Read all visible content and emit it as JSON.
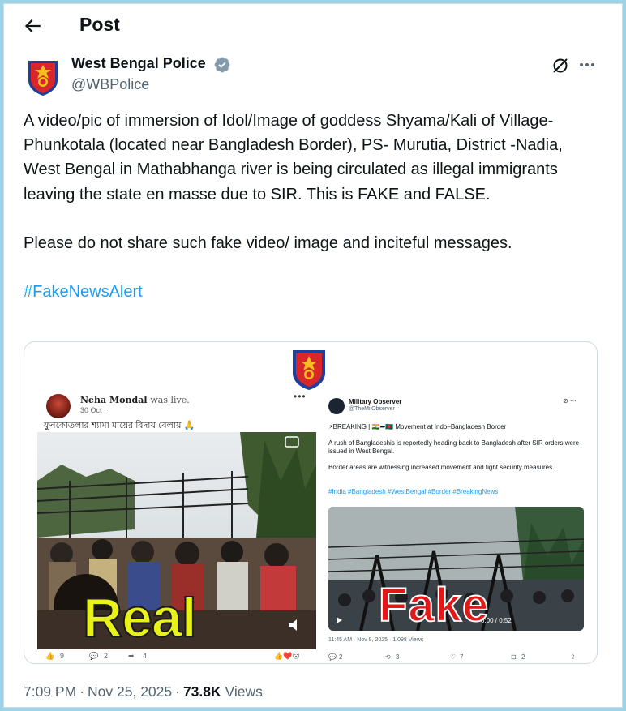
{
  "header": {
    "title": "Post",
    "back_icon": "arrow-left-icon"
  },
  "author": {
    "name": "West Bengal Police",
    "handle": "@WBPolice",
    "verified": true,
    "verified_color": "#829aab"
  },
  "tweet": {
    "paragraph1": "A video/pic of immersion of Idol/Image of goddess Shyama/Kali  of Village-Phunkotala (located near Bangladesh Border), PS- Murutia, District -Nadia, West Bengal in Mathabhanga river is being circulated as illegal immigrants leaving the state en masse due to SIR. This is FAKE and FALSE.",
    "paragraph2": "Please do not share such fake video/ image and inciteful messages.",
    "hashtag": "#FakeNewsAlert"
  },
  "media": {
    "left_post": {
      "name": "Neha Mondal",
      "suffix": "was live.",
      "date": "30 Oct ·",
      "caption": "ফুনকোতলার শ্যামা মায়ের বিদায় বেলায় 🙏",
      "overlay": "Real",
      "actions": [
        "9",
        "2",
        "4"
      ]
    },
    "right_post": {
      "name": "Military Observer",
      "handle": "@TheMilObserver",
      "headline": "⚡BREAKING | 🇮🇳➡🇧🇩 Movement at Indo–Bangladesh Border",
      "line1": "A rush of Bangladeshis is reportedly heading back to Bangladesh after SIR orders were issued in West Bengal.",
      "line2": "Border areas are witnessing increased movement and tight security measures.",
      "tags": "#India #Bangladesh #WestBengal #Border #BreakingNews",
      "overlay": "Fake",
      "video_time": "0:00 / 0:52",
      "meta": "11:45 AM · Nov 9, 2025 · 1,098 Views",
      "actions": [
        "2",
        "3",
        "7",
        "2"
      ]
    }
  },
  "footer": {
    "time": "7:09 PM",
    "date": "Nov 25, 2025",
    "views": "73.8K",
    "views_label": "Views"
  },
  "colors": {
    "accent": "#1d9bf0",
    "muted": "#536471",
    "border": "#cfd9de",
    "page_bg": "#9dd3e6"
  }
}
